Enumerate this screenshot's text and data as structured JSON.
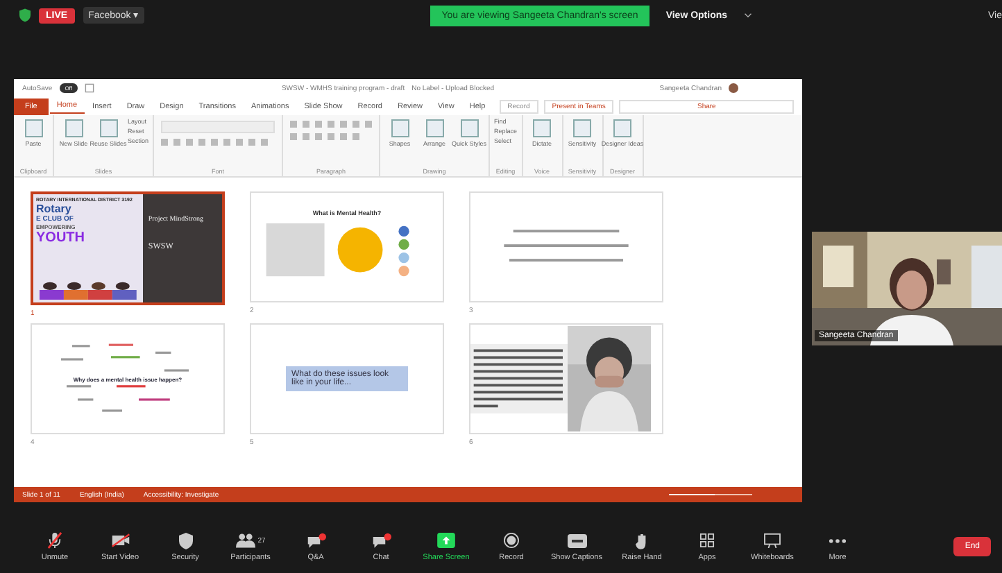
{
  "top_bar": {
    "live_badge": "LIVE",
    "stream": "Facebook ▾",
    "banner": "You are viewing Sangeeta Chandran's screen",
    "view_options": "View Options",
    "view": "Vie"
  },
  "powerpoint": {
    "autosave": {
      "label": "AutoSave",
      "on": false,
      "state_text": "Off"
    },
    "title": "SWSW - WMHS training program - draft",
    "label_status": "No Label - Upload Blocked",
    "user": "Sangeeta Chandran",
    "tabs": [
      {
        "label": "File",
        "kind": "file",
        "selected": false
      },
      {
        "label": "Home",
        "kind": "tab",
        "selected": true
      },
      {
        "label": "Insert",
        "kind": "tab",
        "selected": false
      },
      {
        "label": "Draw",
        "kind": "tab",
        "selected": false
      },
      {
        "label": "Design",
        "kind": "tab",
        "selected": false
      },
      {
        "label": "Transitions",
        "kind": "tab",
        "selected": false
      },
      {
        "label": "Animations",
        "kind": "tab",
        "selected": false
      },
      {
        "label": "Slide Show",
        "kind": "tab",
        "selected": false
      },
      {
        "label": "Record",
        "kind": "tab",
        "selected": false
      },
      {
        "label": "Review",
        "kind": "tab",
        "selected": false
      },
      {
        "label": "View",
        "kind": "tab",
        "selected": false
      },
      {
        "label": "Help",
        "kind": "tab",
        "selected": false
      }
    ],
    "right_buttons": [
      {
        "label": "Record",
        "kind": "record"
      },
      {
        "label": "Present in Teams",
        "kind": "teams"
      },
      {
        "label": "Share",
        "kind": "share"
      }
    ],
    "ribbon_groups": [
      {
        "label": "Clipboard",
        "buttons": [
          "Paste"
        ]
      },
      {
        "label": "Slides",
        "buttons": [
          "New Slide",
          "Reuse Slides"
        ],
        "small": [
          "Layout",
          "Reset",
          "Section"
        ]
      },
      {
        "label": "Font",
        "kind": "font"
      },
      {
        "label": "Paragraph",
        "kind": "paragraph"
      },
      {
        "label": "Drawing",
        "buttons": [
          "Shapes",
          "Arrange",
          "Quick Styles"
        ]
      },
      {
        "label": "Editing",
        "small": [
          "Find",
          "Replace",
          "Select"
        ]
      },
      {
        "label": "Voice",
        "buttons": [
          "Dictate"
        ]
      },
      {
        "label": "Sensitivity",
        "buttons": [
          "Sensitivity"
        ]
      },
      {
        "label": "Designer",
        "buttons": [
          "Designer Ideas"
        ]
      }
    ],
    "slides": [
      {
        "number": "1",
        "kind": "title",
        "selected": true,
        "header": "ROTARY INTERNATIONAL DISTRICT 3192",
        "lines": [
          "Rotary",
          "E CLUB OF",
          "EMPOWERING",
          "YOUTH"
        ],
        "project": "Project MindStrong",
        "code": "SWSW"
      },
      {
        "number": "2",
        "kind": "diagram",
        "selected": false,
        "title": "What is Mental Health?"
      },
      {
        "number": "3",
        "kind": "text_lines",
        "selected": false
      },
      {
        "number": "4",
        "kind": "word_cloud",
        "selected": false,
        "question": "Why does a mental health issue happen?"
      },
      {
        "number": "5",
        "kind": "callout",
        "selected": false,
        "text": "What do these issues look like in your life..."
      },
      {
        "number": "6",
        "kind": "text_photo",
        "selected": false
      }
    ],
    "status_bar": {
      "slide_count": "Slide 1 of 11",
      "language": "English (India)",
      "accessibility": "Accessibility: Investigate",
      "zoom": {
        "level": 0.55
      }
    }
  },
  "webcam": {
    "name": "Sangeeta Chandran"
  },
  "toolbar": [
    {
      "label": "Unmute",
      "kind": "mic"
    },
    {
      "label": "Start Video",
      "kind": "video"
    },
    {
      "label": "Security",
      "kind": "shield"
    },
    {
      "label": "Participants",
      "kind": "people",
      "count": "27"
    },
    {
      "label": "Q&A",
      "kind": "qa"
    },
    {
      "label": "Chat",
      "kind": "chat"
    },
    {
      "label": "Share Screen",
      "kind": "share"
    },
    {
      "label": "Record",
      "kind": "record"
    },
    {
      "label": "Show Captions",
      "kind": "cc"
    },
    {
      "label": "Raise Hand",
      "kind": "hand"
    },
    {
      "label": "Apps",
      "kind": "apps"
    },
    {
      "label": "Whiteboards",
      "kind": "board"
    },
    {
      "label": "More",
      "kind": "more"
    }
  ],
  "end_button": "End"
}
